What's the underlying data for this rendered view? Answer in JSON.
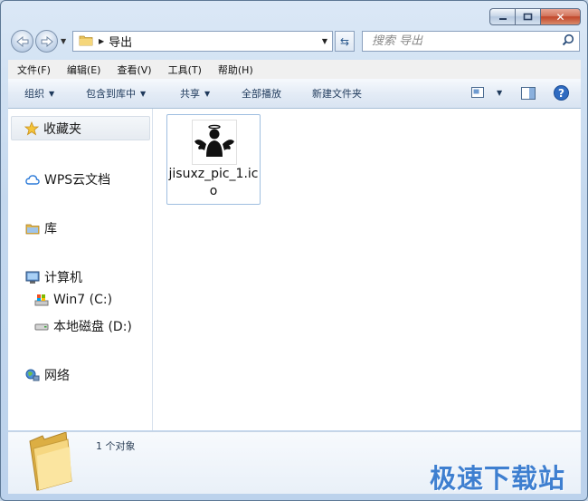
{
  "window": {
    "close_glyph": "✕"
  },
  "address": {
    "crumb": "导出"
  },
  "search": {
    "placeholder": "搜索 导出"
  },
  "menu": [
    {
      "label": "文件(F)"
    },
    {
      "label": "编辑(E)"
    },
    {
      "label": "查看(V)"
    },
    {
      "label": "工具(T)"
    },
    {
      "label": "帮助(H)"
    }
  ],
  "toolbar": {
    "organize": "组织",
    "include": "包含到库中",
    "share": "共享",
    "burn": "全部播放",
    "new_folder": "新建文件夹"
  },
  "nav": {
    "favorites": "收藏夹",
    "wps": "WPS云文档",
    "library": "库",
    "computer": "计算机",
    "drive_c": "Win7 (C:)",
    "drive_d": "本地磁盘 (D:)",
    "network": "网络"
  },
  "files": [
    {
      "name": "jisuxz_pic_1.ico"
    }
  ],
  "details": {
    "count": "1 个对象",
    "watermark": "极速下载站"
  },
  "colors": {
    "accent": "#3e7fd0",
    "close": "#c1462a"
  }
}
